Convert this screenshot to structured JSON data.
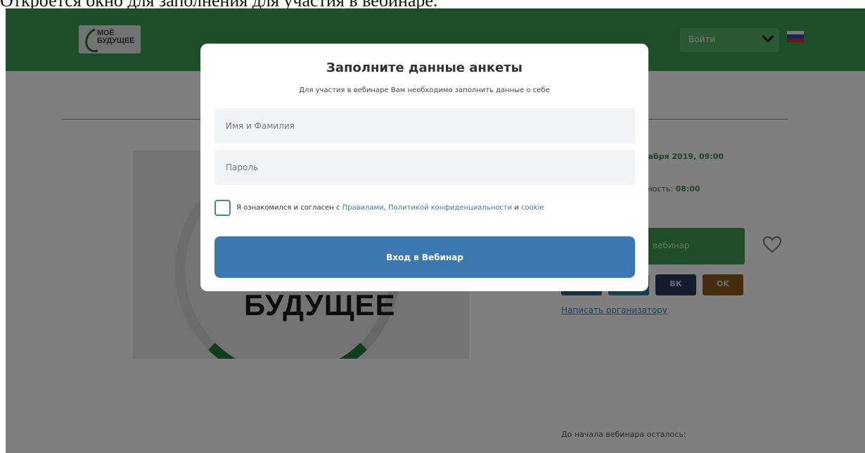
{
  "caption": "Откроется окно для заполнения для участия в вебинаре.",
  "header": {
    "logo_line1": "МОЁ",
    "logo_line2": "БУДУЩЕЕ",
    "login_label": "Войти"
  },
  "hero": {
    "text": "БУДУЩЕЕ"
  },
  "event": {
    "date_partial": "кабря 2019, 09:00",
    "duration_label": "ьность:",
    "duration_value": "08:00",
    "register_partial": "вебинар",
    "social": [
      "ВК",
      "OK"
    ],
    "organizer_link": "Написать организатору",
    "countdown_label": "До начала вебинара осталось:"
  },
  "modal": {
    "title": "Заполните данные анкеты",
    "subtitle": "Для участия в вебинаре Вам необходимо заполнить данные о себе",
    "name_placeholder": "Имя и Фамилия",
    "password_placeholder": "Пароль",
    "agree_prefix": "Я ознакомился и согласен с ",
    "rules_link": "Правилами",
    "comma": ", ",
    "privacy_link": "Политикой конфиденциальности",
    "and_word": " и ",
    "cookie_link": "cookie",
    "submit_label": "Вход в Вебинар"
  },
  "colors": {
    "header_green": "#3d9a52",
    "modal_blue": "#3b78b0"
  }
}
